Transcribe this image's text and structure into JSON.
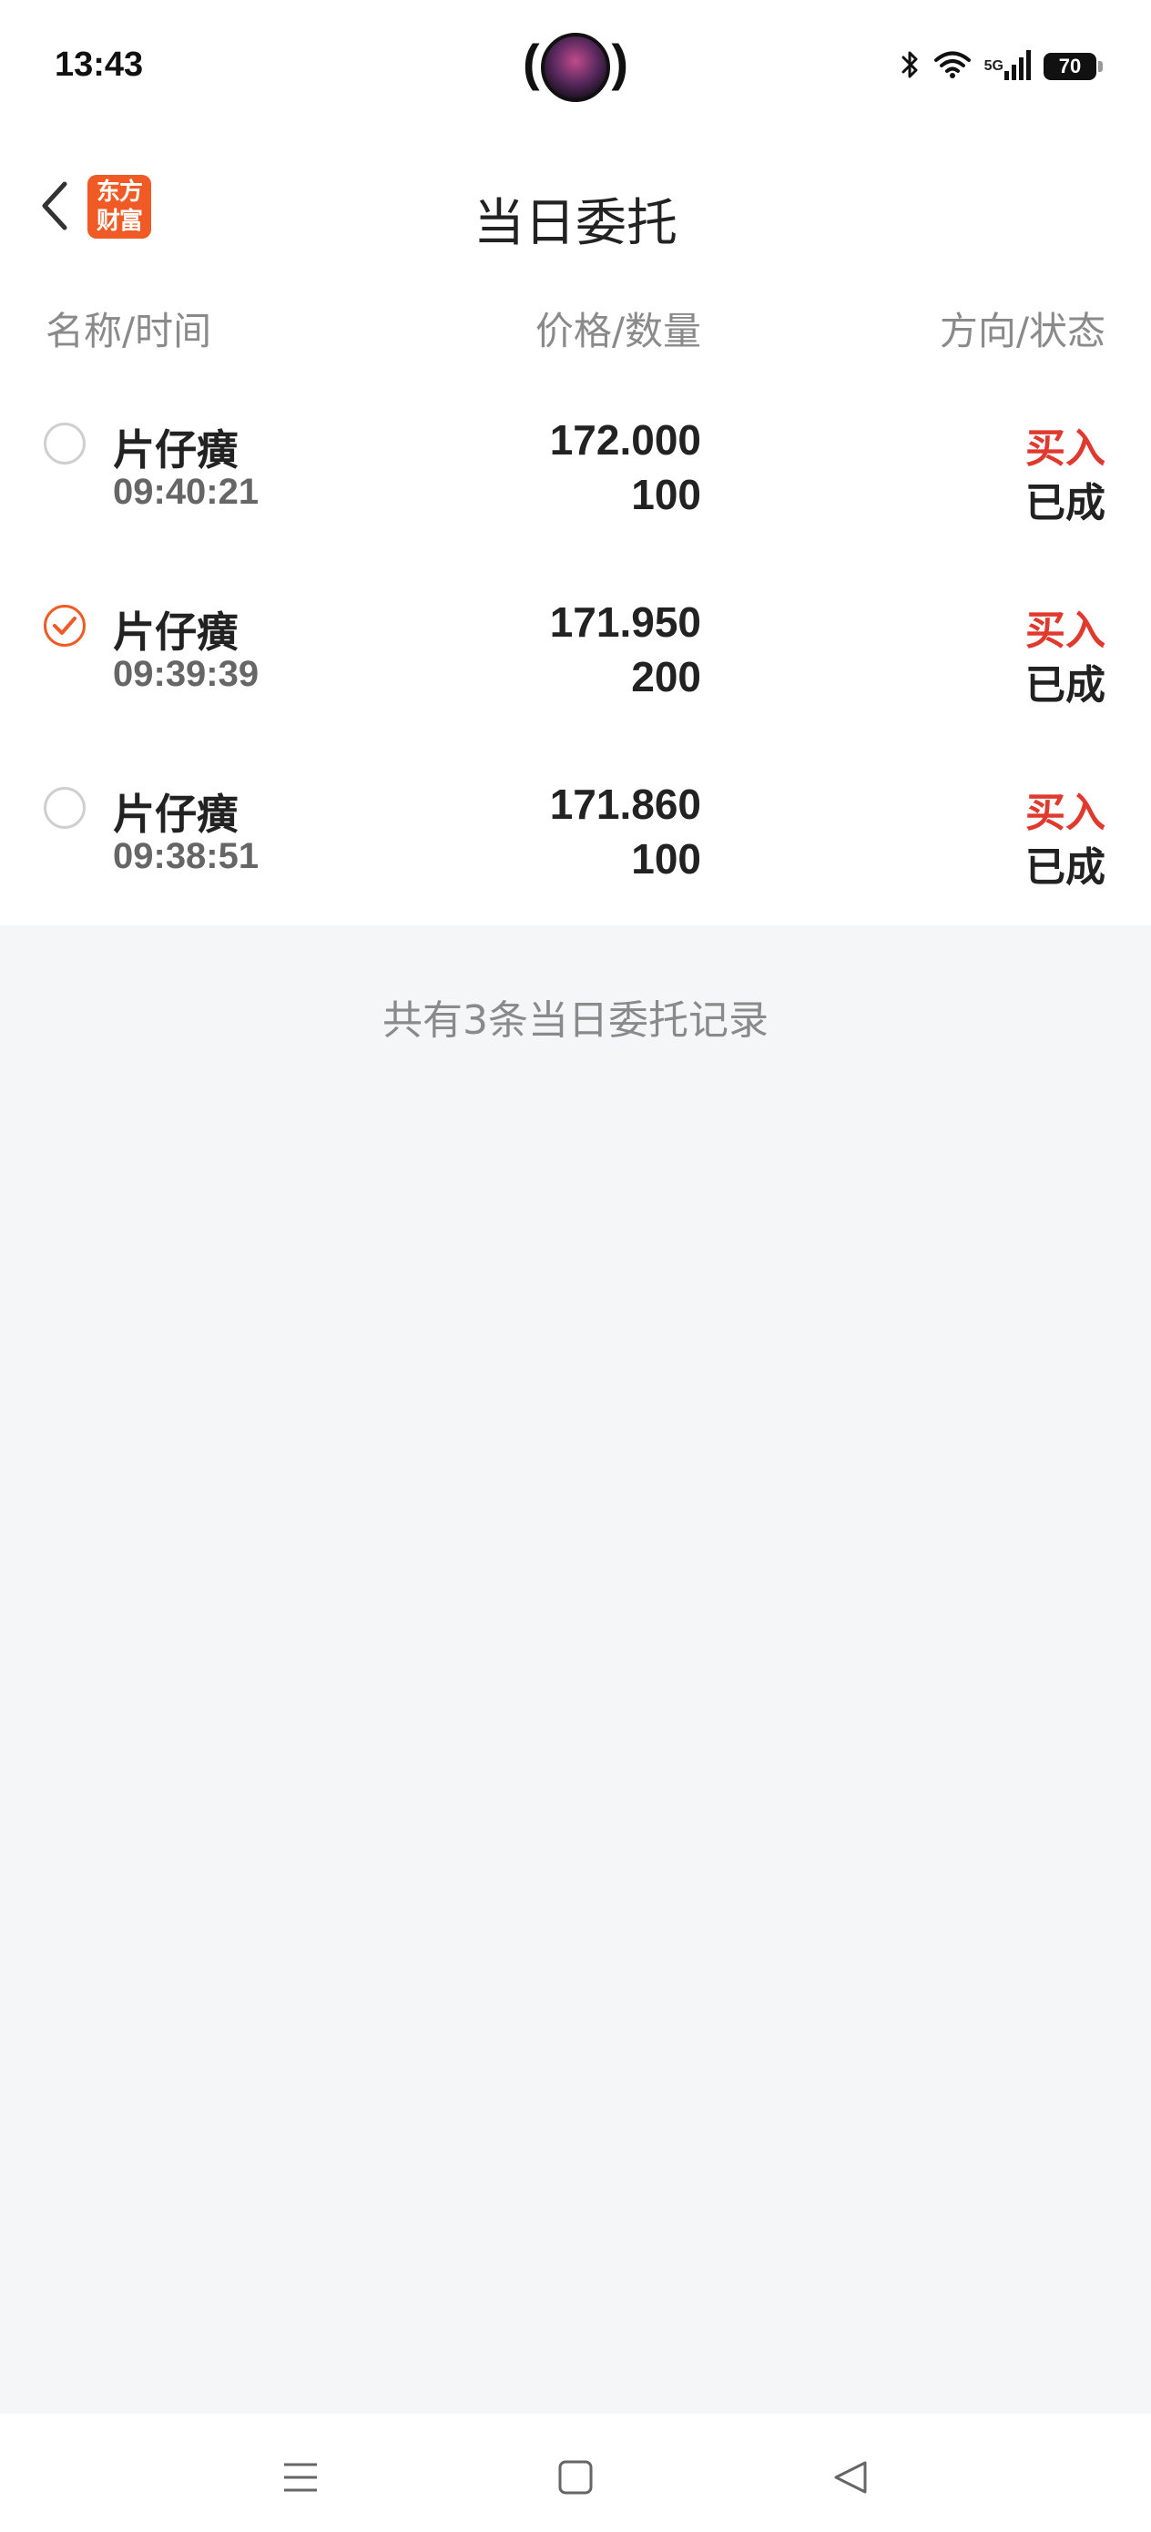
{
  "status_bar": {
    "time": "13:43",
    "network": "5G",
    "battery": "70"
  },
  "header": {
    "title": "当日委托",
    "logo_text_line1": "东方",
    "logo_text_line2": "财富"
  },
  "columns": {
    "name_time": "名称/时间",
    "price_qty": "价格/数量",
    "direction_status": "方向/状态"
  },
  "orders": [
    {
      "name": "片仔癀",
      "time": "09:40:21",
      "price": "172.000",
      "quantity": "100",
      "direction": "买入",
      "status": "已成",
      "selected": false
    },
    {
      "name": "片仔癀",
      "time": "09:39:39",
      "price": "171.950",
      "quantity": "200",
      "direction": "买入",
      "status": "已成",
      "selected": true
    },
    {
      "name": "片仔癀",
      "time": "09:38:51",
      "price": "171.860",
      "quantity": "100",
      "direction": "买入",
      "status": "已成",
      "selected": false
    }
  ],
  "summary": "共有3条当日委托记录",
  "colors": {
    "accent": "#f05a24",
    "buy": "#e03a2f"
  }
}
